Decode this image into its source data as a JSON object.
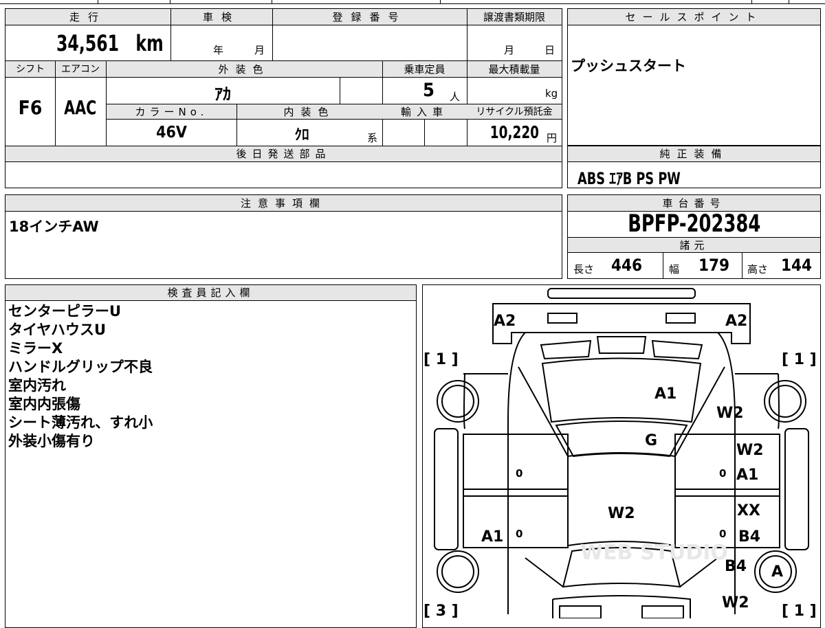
{
  "vehicle": {
    "mileage_label": "走行",
    "mileage_value": "34,561",
    "mileage_unit": "km",
    "shaken_label": "車検",
    "shaken_year_unit": "年",
    "shaken_month_unit": "月",
    "reg_number_label": "登録番号",
    "transfer_label": "譲渡書類期限",
    "transfer_month_unit": "月",
    "transfer_day_unit": "日",
    "shift_label": "シフト",
    "shift_value": "F6",
    "ac_label": "エアコン",
    "ac_value": "AAC",
    "exterior_color_label": "外装色",
    "exterior_color_value": "ｱｶ",
    "capacity_label": "乗車定員",
    "capacity_value": "5",
    "capacity_unit": "人",
    "max_load_label": "最大積載量",
    "max_load_unit": "kg",
    "color_no_label": "カラーNo.",
    "color_no_value": "46V",
    "interior_color_label": "内装色",
    "interior_color_value": "ｸﾛ",
    "interior_color_suffix": "系",
    "import_label": "輸入車",
    "recycle_label": "リサイクル預託金",
    "recycle_value": "10,220",
    "recycle_unit": "円"
  },
  "sales_point": {
    "label": "セールスポイント",
    "text": "プッシュスタート"
  },
  "later_parts": {
    "label": "後日発送部品"
  },
  "standard_equipment": {
    "label": "純正装備",
    "text": "ABS ｴｱB PS PW"
  },
  "caution": {
    "label": "注意事項欄",
    "text": "18インチAW"
  },
  "chassis": {
    "label": "車台番号",
    "value": "BPFP-202384"
  },
  "specs": {
    "label": "諸元",
    "length_label": "長さ",
    "length_value": "446",
    "width_label": "幅",
    "width_value": "179",
    "height_label": "高さ",
    "height_value": "144"
  },
  "inspector": {
    "label": "検査員記入欄",
    "notes": [
      "センターピラーU",
      "タイヤハウスU",
      "ミラーX",
      "ハンドルグリップ不良",
      "室内汚れ",
      "室内内張傷",
      "シート薄汚れ、すれ小",
      "外装小傷有り"
    ]
  },
  "diagram": {
    "marks": {
      "a2_left": "A2",
      "a2_right": "A2",
      "tire_fl": "[ 1 ]",
      "tire_fr": "[ 1 ]",
      "tire_rl": "[ 3 ]",
      "tire_rr": "[ 1 ]",
      "hood": "A1",
      "fender_fr": "W2",
      "windshield": "G",
      "door_fr_1": "W2",
      "door_fr_2": "A1",
      "roof": "W2",
      "door_rr_1": "XX",
      "door_rr_2": "B4",
      "door_rl": "A1",
      "rear_fender_r": "B4",
      "spare": "A",
      "rear_r": "W2",
      "zero_1": "0",
      "zero_2": "0",
      "zero_3": "0",
      "zero_4": "0"
    },
    "watermark": "WEB STUDIO"
  }
}
